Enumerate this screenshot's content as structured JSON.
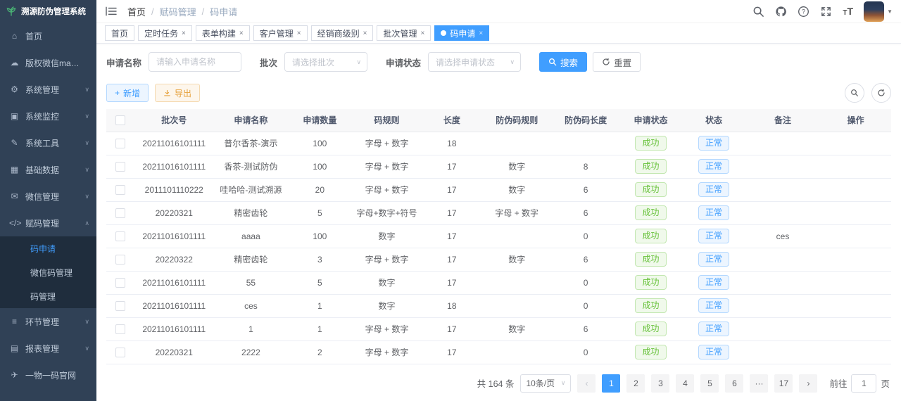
{
  "app": {
    "title": "溯源防伪管理系统"
  },
  "sidebar": {
    "logo_title": "溯源防伪管理系统",
    "items": [
      {
        "label": "首页",
        "icon": "dashboard",
        "arrow": ""
      },
      {
        "label": "版权微信mao-clouds",
        "icon": "cloud",
        "arrow": ""
      },
      {
        "label": "系统管理",
        "icon": "gear",
        "arrow": "down"
      },
      {
        "label": "系统监控",
        "icon": "monitor",
        "arrow": "down"
      },
      {
        "label": "系统工具",
        "icon": "tools",
        "arrow": "down"
      },
      {
        "label": "基础数据",
        "icon": "grid",
        "arrow": "down"
      },
      {
        "label": "微信管理",
        "icon": "wechat",
        "arrow": "down"
      },
      {
        "label": "赋码管理",
        "icon": "code",
        "arrow": "up",
        "children": [
          {
            "label": "码申请",
            "active": true
          },
          {
            "label": "微信码管理",
            "active": false
          },
          {
            "label": "码管理",
            "active": false
          }
        ]
      },
      {
        "label": "环节管理",
        "icon": "list",
        "arrow": "down"
      },
      {
        "label": "报表管理",
        "icon": "report",
        "arrow": "down"
      },
      {
        "label": "一物一码官网",
        "icon": "plane",
        "arrow": ""
      }
    ]
  },
  "navbar": {
    "breadcrumb": [
      "首页",
      "赋码管理",
      "码申请"
    ]
  },
  "tabs": [
    {
      "label": "首页",
      "closable": false,
      "active": false
    },
    {
      "label": "定时任务",
      "closable": true,
      "active": false
    },
    {
      "label": "表单构建",
      "closable": true,
      "active": false
    },
    {
      "label": "客户管理",
      "closable": true,
      "active": false
    },
    {
      "label": "经销商级别",
      "closable": true,
      "active": false
    },
    {
      "label": "批次管理",
      "closable": true,
      "active": false
    },
    {
      "label": "码申请",
      "closable": true,
      "active": true
    }
  ],
  "filters": {
    "name_label": "申请名称",
    "name_placeholder": "请输入申请名称",
    "batch_label": "批次",
    "batch_placeholder": "请选择批次",
    "status_label": "申请状态",
    "status_placeholder": "请选择申请状态",
    "search_label": "搜索",
    "reset_label": "重置"
  },
  "actions": {
    "add_label": "新增",
    "export_label": "导出"
  },
  "table": {
    "headers": [
      "批次号",
      "申请名称",
      "申请数量",
      "码规则",
      "长度",
      "防伪码规则",
      "防伪码长度",
      "申请状态",
      "状态",
      "备注",
      "操作"
    ],
    "rows": [
      {
        "batch": "20211016101111",
        "name": "普尔香茶-演示",
        "qty": "100",
        "rule": "字母 + 数字",
        "len": "18",
        "anti_rule": "",
        "anti_len": "",
        "apply": "成功",
        "status": "正常",
        "remark": ""
      },
      {
        "batch": "20211016101111",
        "name": "香茶-测试防伪",
        "qty": "100",
        "rule": "字母 + 数字",
        "len": "17",
        "anti_rule": "数字",
        "anti_len": "8",
        "apply": "成功",
        "status": "正常",
        "remark": ""
      },
      {
        "batch": "2011101110222",
        "name": "哇哈哈-测试溯源",
        "qty": "20",
        "rule": "字母 + 数字",
        "len": "17",
        "anti_rule": "数字",
        "anti_len": "6",
        "apply": "成功",
        "status": "正常",
        "remark": ""
      },
      {
        "batch": "20220321",
        "name": "精密齿轮",
        "qty": "5",
        "rule": "字母+数字+符号",
        "len": "17",
        "anti_rule": "字母 + 数字",
        "anti_len": "6",
        "apply": "成功",
        "status": "正常",
        "remark": ""
      },
      {
        "batch": "20211016101111",
        "name": "aaaa",
        "qty": "100",
        "rule": "数字",
        "len": "17",
        "anti_rule": "",
        "anti_len": "0",
        "apply": "成功",
        "status": "正常",
        "remark": "ces"
      },
      {
        "batch": "20220322",
        "name": "精密齿轮",
        "qty": "3",
        "rule": "字母 + 数字",
        "len": "17",
        "anti_rule": "数字",
        "anti_len": "6",
        "apply": "成功",
        "status": "正常",
        "remark": ""
      },
      {
        "batch": "20211016101111",
        "name": "55",
        "qty": "5",
        "rule": "数字",
        "len": "17",
        "anti_rule": "",
        "anti_len": "0",
        "apply": "成功",
        "status": "正常",
        "remark": ""
      },
      {
        "batch": "20211016101111",
        "name": "ces",
        "qty": "1",
        "rule": "数字",
        "len": "18",
        "anti_rule": "",
        "anti_len": "0",
        "apply": "成功",
        "status": "正常",
        "remark": ""
      },
      {
        "batch": "20211016101111",
        "name": "1",
        "qty": "1",
        "rule": "字母 + 数字",
        "len": "17",
        "anti_rule": "数字",
        "anti_len": "6",
        "apply": "成功",
        "status": "正常",
        "remark": ""
      },
      {
        "batch": "20220321",
        "name": "2222",
        "qty": "2",
        "rule": "字母 + 数字",
        "len": "17",
        "anti_rule": "",
        "anti_len": "0",
        "apply": "成功",
        "status": "正常",
        "remark": ""
      }
    ]
  },
  "pagination": {
    "total_text": "共 164 条",
    "page_size": "10条/页",
    "pages": [
      "1",
      "2",
      "3",
      "4",
      "5",
      "6",
      "···",
      "17"
    ],
    "active_page": "1",
    "goto_label": "前往",
    "goto_value": "1",
    "goto_suffix": "页"
  },
  "colors": {
    "accent": "#409eff",
    "sidebar_bg": "#304156",
    "submenu_bg": "#1f2d3d",
    "success": "#67c23a",
    "warning": "#e6a23c"
  }
}
